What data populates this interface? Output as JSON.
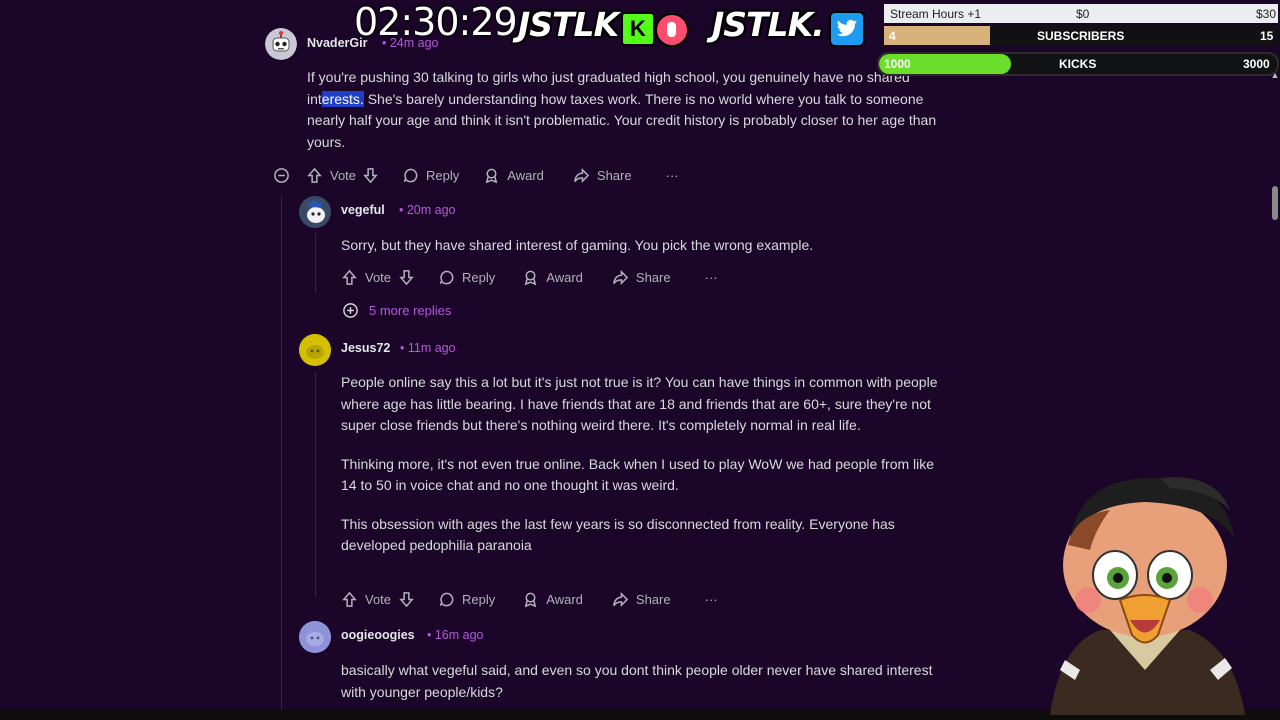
{
  "overlay": {
    "clock": "02:30:29",
    "logo_left": "JSTLK",
    "logo_right": "JSTLK.",
    "badge_k": "K",
    "goals": {
      "stream_hours_label": "Stream Hours +1",
      "stream_hours_current": "$0",
      "stream_hours_target": "$30",
      "subs_current": "4",
      "subs_label": "SUBSCRIBERS",
      "subs_target": "15",
      "subs_progress": 0.27,
      "kicks_current": "1000",
      "kicks_label": "KICKS",
      "kicks_target": "3000",
      "kicks_progress": 0.33
    }
  },
  "comments": [
    {
      "username": "NvaderGir",
      "time": "• 24m ago",
      "text_before": "If you're pushing 30 talking to girls who just graduated high school, you genuinely have no shared int",
      "text_highlight": "erests.",
      "text_after": " She's barely understanding how taxes work. There is no world where you talk to someone nearly half your age and think it isn't problematic. Your credit history is probably closer to her age than yours.",
      "actions": {
        "vote": "Vote",
        "reply": "Reply",
        "award": "Award",
        "share": "Share",
        "more": "···"
      }
    },
    {
      "username": "vegeful",
      "time": "• 20m ago",
      "text": "Sorry, but they have shared interest of gaming. You pick the wrong example.",
      "actions": {
        "vote": "Vote",
        "reply": "Reply",
        "award": "Award",
        "share": "Share",
        "more": "···"
      },
      "more_replies": "5 more replies"
    },
    {
      "username": "Jesus72",
      "time": "• 11m ago",
      "paragraphs": [
        "People online say this a lot but it's just not true is it? You can have things in common with people where age has little bearing. I have friends that are 18 and friends that are 60+, sure they're not super close friends but there's nothing weird there. It's completely normal in real life.",
        "Thinking more, it's not even true online. Back when I used to play WoW we had people from like 14 to 50 in voice chat and no one thought it was weird.",
        "This obsession with ages the last few years is so disconnected from reality. Everyone has developed pedophilia paranoia"
      ],
      "actions": {
        "vote": "Vote",
        "reply": "Reply",
        "award": "Award",
        "share": "Share",
        "more": "···"
      }
    },
    {
      "username": "oogieoogies",
      "time": "• 16m ago",
      "text": "basically what vegeful said, and even so you dont think people older never have shared interest with younger people/kids?"
    }
  ]
}
